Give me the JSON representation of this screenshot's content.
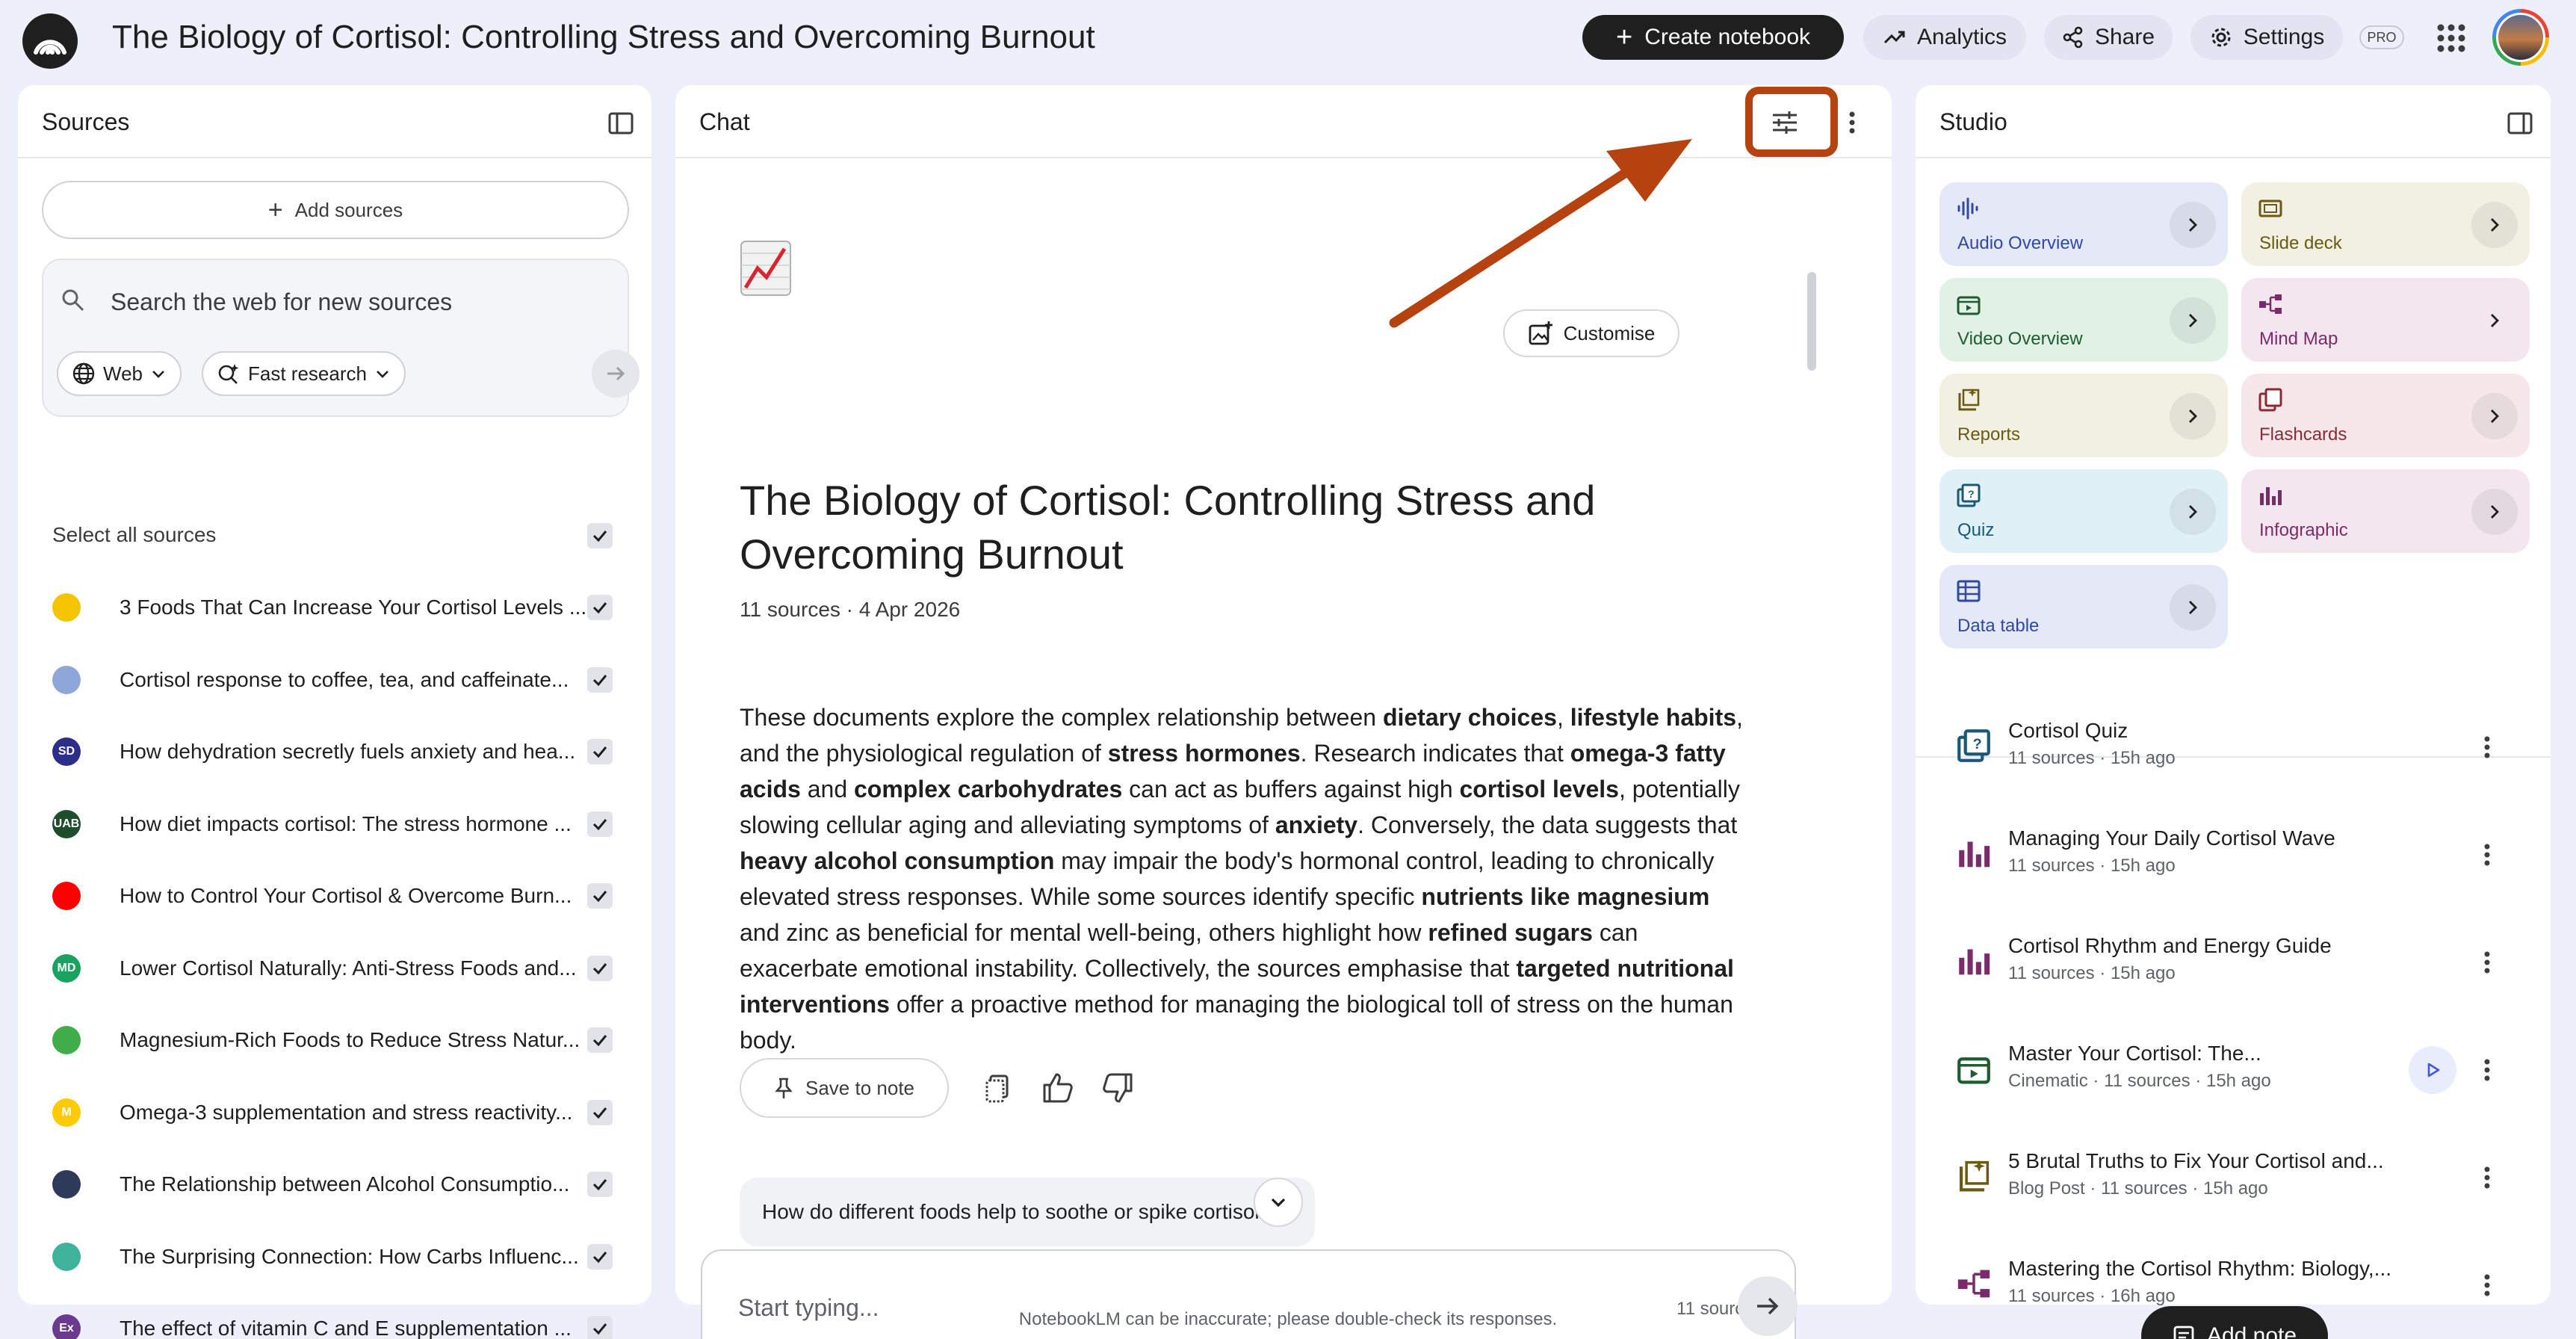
{
  "header": {
    "title": "The Biology of Cortisol: Controlling Stress and Overcoming Burnout",
    "create_notebook": "Create notebook",
    "analytics": "Analytics",
    "share": "Share",
    "settings": "Settings",
    "pro_badge": "PRO"
  },
  "sources": {
    "title": "Sources",
    "add_sources": "Add sources",
    "search_placeholder": "Search the web for new sources",
    "web_chip": "Web",
    "research_chip": "Fast research",
    "select_all": "Select all sources",
    "items": [
      {
        "label": "3 Foods That Can Increase Your Cortisol Levels ...",
        "icon": "sparkle-plus-icon",
        "color": "#f5c400"
      },
      {
        "label": "Cortisol response to coffee, tea, and caffeinate...",
        "icon": "globe-icon",
        "color": "#8fa6d8"
      },
      {
        "label": "How dehydration secretly fuels anxiety and hea...",
        "icon": "sd-logo-icon",
        "color": "#2b2f8a",
        "text": "SD"
      },
      {
        "label": "How diet impacts cortisol: The stress hormone ...",
        "icon": "uab-logo-icon",
        "color": "#1e4d2b",
        "text": "UAB"
      },
      {
        "label": "How to Control Your Cortisol & Overcome Burn...",
        "icon": "youtube-icon",
        "color": "#ff0000"
      },
      {
        "label": "Lower Cortisol Naturally: Anti-Stress Foods and...",
        "icon": "md-logo-icon",
        "color": "#1aa260",
        "text": "MD"
      },
      {
        "label": "Magnesium-Rich Foods to Reduce Stress Natur...",
        "icon": "leaf-bowl-icon",
        "color": "#3fae49"
      },
      {
        "label": "Omega-3 supplementation and stress reactivity...",
        "icon": "michigan-m-icon",
        "color": "#ffcb05",
        "text": "M"
      },
      {
        "label": "The Relationship between Alcohol Consumptio...",
        "icon": "chevron-logo-icon",
        "color": "#2e3a59"
      },
      {
        "label": "The Surprising Connection: How Carbs Influenc...",
        "icon": "circle-logo-icon",
        "color": "#3fb39b"
      },
      {
        "label": "The effect of vitamin C and E supplementation ...",
        "icon": "ex-logo-icon",
        "color": "#6b3a8e",
        "text": "Ex"
      }
    ]
  },
  "chat": {
    "title": "Chat",
    "customise": "Customise",
    "heading": "The Biology of Cortisol: Controlling Stress and Overcoming Burnout",
    "meta": "11 sources · 4 Apr 2026",
    "summary": [
      {
        "t": "These documents explore the complex relationship between "
      },
      {
        "t": "dietary choices",
        "b": true
      },
      {
        "t": ", "
      },
      {
        "t": "lifestyle habits",
        "b": true
      },
      {
        "t": ", and the physiological regulation of "
      },
      {
        "t": "stress hormones",
        "b": true
      },
      {
        "t": ". Research indicates that "
      },
      {
        "t": "omega-3 fatty acids",
        "b": true
      },
      {
        "t": " and "
      },
      {
        "t": "complex carbohydrates",
        "b": true
      },
      {
        "t": " can act as buffers against high "
      },
      {
        "t": "cortisol levels",
        "b": true
      },
      {
        "t": ", potentially slowing cellular aging and alleviating symptoms of "
      },
      {
        "t": "anxiety",
        "b": true
      },
      {
        "t": ". Conversely, the data suggests that "
      },
      {
        "t": "heavy alcohol consumption",
        "b": true
      },
      {
        "t": " may impair the body's hormonal control, leading to chronically elevated stress responses. While some sources identify specific "
      },
      {
        "t": "nutrients like magnesium",
        "b": true
      },
      {
        "t": " and zinc as beneficial for mental well-being, others highlight how "
      },
      {
        "t": "refined sugars",
        "b": true
      },
      {
        "t": " can exacerbate emotional instability. Collectively, the sources emphasise that "
      },
      {
        "t": "targeted nutritional interventions",
        "b": true
      },
      {
        "t": " offer a proactive method for managing the biological toll of stress on the human body."
      }
    ],
    "save_to_note": "Save to note",
    "suggestion": "How do different foods help to soothe or spike cortisol",
    "input_placeholder": "Start typing...",
    "source_count": "11 sources"
  },
  "studio": {
    "title": "Studio",
    "tiles": [
      {
        "label": "Audio Overview",
        "icon": "audio-waveform-icon",
        "bg": "#e5e8f7",
        "fg": "#2f4a9e",
        "arrow": true
      },
      {
        "label": "Slide deck",
        "icon": "slides-icon",
        "bg": "#f1f0e3",
        "fg": "#6b5a12",
        "arrow": true
      },
      {
        "label": "Video Overview",
        "icon": "video-icon",
        "bg": "#e1f1e6",
        "fg": "#1f5c31",
        "arrow": true
      },
      {
        "label": "Mind Map",
        "icon": "mindmap-icon",
        "bg": "#f3e6ef",
        "fg": "#7b2a6b",
        "arrow": false
      },
      {
        "label": "Reports",
        "icon": "reports-icon",
        "bg": "#f1f0e3",
        "fg": "#6b5a12",
        "arrow": true
      },
      {
        "label": "Flashcards",
        "icon": "flashcards-icon",
        "bg": "#f6e8ea",
        "fg": "#8a2a35",
        "arrow": true
      },
      {
        "label": "Quiz",
        "icon": "quiz-icon",
        "bg": "#dff0f6",
        "fg": "#1a5a78",
        "arrow": true
      },
      {
        "label": "Infographic",
        "icon": "infographic-icon",
        "bg": "#f3e6ef",
        "fg": "#7b2a6b",
        "arrow": true
      },
      {
        "label": "Data table",
        "icon": "table-icon",
        "bg": "#e5e8f7",
        "fg": "#2f4a9e",
        "arrow": true
      }
    ],
    "notes": [
      {
        "title": "Cortisol Quiz",
        "sub": "11 sources · 15h ago",
        "icon": "quiz-icon",
        "color": "#1a5a78"
      },
      {
        "title": "Managing Your Daily Cortisol Wave",
        "sub": "11 sources · 15h ago",
        "icon": "infographic-icon",
        "color": "#7b2a6b"
      },
      {
        "title": "Cortisol Rhythm and Energy Guide",
        "sub": "11 sources · 15h ago",
        "icon": "infographic-icon",
        "color": "#7b2a6b"
      },
      {
        "title": "Master Your Cortisol: The...",
        "sub": "Cinematic · 11 sources · 15h ago",
        "icon": "video-icon",
        "color": "#1f5c31"
      },
      {
        "title": "5 Brutal Truths to Fix Your Cortisol and...",
        "sub": "Blog Post · 11 sources · 15h ago",
        "icon": "reports-icon",
        "color": "#6b5a12"
      },
      {
        "title": "Mastering the Cortisol Rhythm: Biology,...",
        "sub": "11 sources · 16h ago",
        "icon": "mindmap-icon",
        "color": "#7b2a6b"
      }
    ],
    "add_note": "Add note"
  },
  "footer": {
    "disclaimer": "NotebookLM can be inaccurate; please double-check its responses."
  }
}
